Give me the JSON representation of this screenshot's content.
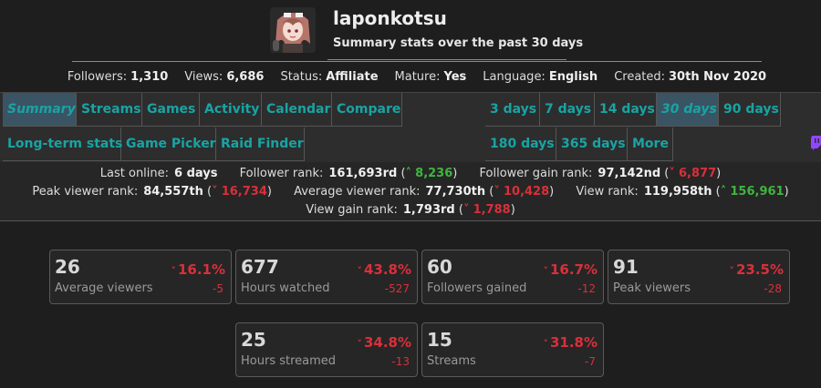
{
  "profile": {
    "username": "laponkotsu",
    "subtitle": "Summary stats over the past 30 days"
  },
  "info": [
    {
      "label": "Followers:",
      "value": "1,310"
    },
    {
      "label": "Views:",
      "value": "6,686"
    },
    {
      "label": "Status:",
      "value": "Affiliate"
    },
    {
      "label": "Mature:",
      "value": "Yes"
    },
    {
      "label": "Language:",
      "value": "English"
    },
    {
      "label": "Created:",
      "value": "30th Nov 2020"
    }
  ],
  "nav_tabs": [
    {
      "label": "Summary",
      "active": true
    },
    {
      "label": "Streams"
    },
    {
      "label": "Games"
    },
    {
      "label": "Activity"
    },
    {
      "label": "Calendar"
    },
    {
      "label": "Compare"
    },
    {
      "label": "Long-term stats"
    },
    {
      "label": "Game Picker"
    },
    {
      "label": "Raid Finder"
    }
  ],
  "period_tabs": [
    {
      "label": "3 days"
    },
    {
      "label": "7 days"
    },
    {
      "label": "14 days"
    },
    {
      "label": "30 days",
      "active": true
    },
    {
      "label": "90 days"
    },
    {
      "label": "180 days"
    },
    {
      "label": "365 days"
    },
    {
      "label": "More"
    }
  ],
  "ranks": {
    "last_online": {
      "label": "Last online:",
      "value": "6 days"
    },
    "follower_rank": {
      "label": "Follower rank:",
      "value": "161,693rd",
      "change": "8,236",
      "dir": "up"
    },
    "follower_gain_rank": {
      "label": "Follower gain rank:",
      "value": "97,142nd",
      "change": "6,877",
      "dir": "down"
    },
    "peak_viewer_rank": {
      "label": "Peak viewer rank:",
      "value": "84,557th",
      "change": "16,734",
      "dir": "down"
    },
    "average_viewer_rank": {
      "label": "Average viewer rank:",
      "value": "77,730th",
      "change": "10,428",
      "dir": "down"
    },
    "view_rank": {
      "label": "View rank:",
      "value": "119,958th",
      "change": "156,961",
      "dir": "up"
    },
    "view_gain_rank": {
      "label": "View gain rank:",
      "value": "1,793rd",
      "change": "1,788",
      "dir": "down"
    }
  },
  "cards": [
    {
      "value": "26",
      "label": "Average viewers",
      "pct": "16.1%",
      "delta": "-5"
    },
    {
      "value": "677",
      "label": "Hours watched",
      "pct": "43.8%",
      "delta": "-527"
    },
    {
      "value": "60",
      "label": "Followers gained",
      "pct": "16.7%",
      "delta": "-12"
    },
    {
      "value": "91",
      "label": "Peak viewers",
      "pct": "23.5%",
      "delta": "-28"
    },
    {
      "value": "25",
      "label": "Hours streamed",
      "pct": "34.8%",
      "delta": "-13"
    },
    {
      "value": "15",
      "label": "Streams",
      "pct": "31.8%",
      "delta": "-7"
    }
  ],
  "colors": {
    "accent": "#1aa3a3",
    "up": "#3fb53f",
    "down": "#d9303a",
    "active_tab_bg": "#3a5464"
  },
  "icons": {
    "twitch": "twitch-icon",
    "down": "chevron-down-icon",
    "up": "chevron-up-icon"
  }
}
